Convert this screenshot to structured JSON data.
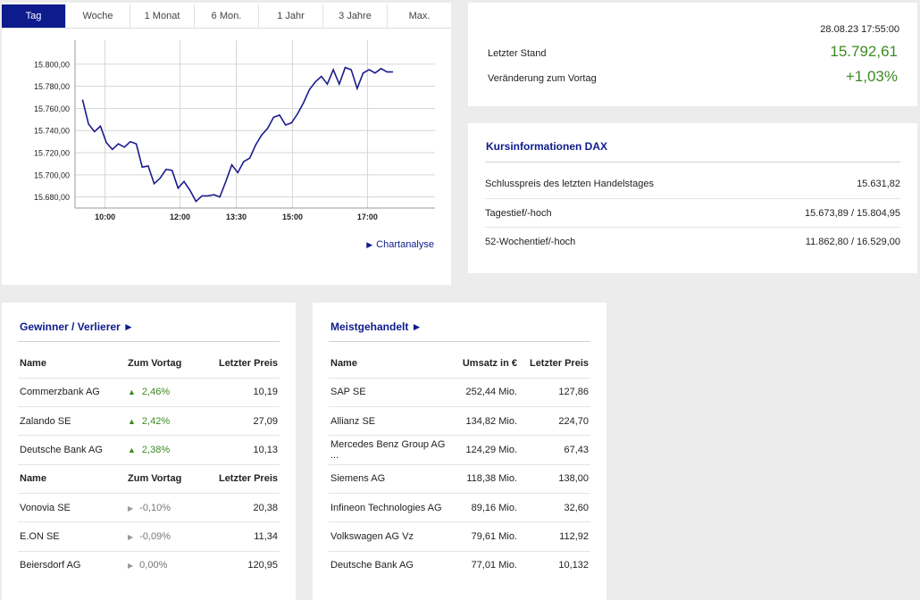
{
  "tabs": [
    "Tag",
    "Woche",
    "1 Monat",
    "6 Mon.",
    "1 Jahr",
    "3 Jahre",
    "Max."
  ],
  "active_tab": 0,
  "chart_link": "Chartanalyse",
  "chart_data": {
    "type": "line",
    "x_ticks": [
      "10:00",
      "12:00",
      "13:30",
      "15:00",
      "17:00"
    ],
    "y_ticks": [
      "15.800,00",
      "15.780,00",
      "15.760,00",
      "15.740,00",
      "15.720,00",
      "15.700,00",
      "15.680,00"
    ],
    "ylim": [
      15670,
      15812
    ],
    "xlim": [
      0,
      48
    ],
    "x_tick_positions": [
      4,
      14,
      21.5,
      29,
      39
    ],
    "y_tick_values": [
      15800,
      15780,
      15760,
      15740,
      15720,
      15700,
      15680
    ],
    "series": [
      {
        "color": "#1a1a8c",
        "values": [
          15768,
          15746,
          15739,
          15744,
          15729,
          15723,
          15728,
          15725,
          15730,
          15728,
          15707,
          15708,
          15692,
          15697,
          15705,
          15704,
          15688,
          15694,
          15686,
          15676,
          15681,
          15681,
          15682,
          15680,
          15694,
          15709,
          15702,
          15712,
          15715,
          15727,
          15736,
          15742,
          15752,
          15754,
          15745,
          15747,
          15755,
          15765,
          15777,
          15784,
          15789,
          15782,
          15795,
          15782,
          15797,
          15795,
          15778,
          15792,
          15795,
          15792,
          15796,
          15793,
          15793
        ]
      }
    ]
  },
  "stand": {
    "datetime": "28.08.23 17:55:00",
    "last_label": "Letzter Stand",
    "last_value": "15.792,61",
    "change_label": "Veränderung zum Vortag",
    "change_value": "+1,03%"
  },
  "kurs": {
    "title": "Kursinformationen DAX",
    "rows": [
      {
        "label": "Schlusspreis des letzten Handelstages",
        "value": "15.631,82"
      },
      {
        "label": "Tagestief/-hoch",
        "value": "15.673,89 / 15.804,95"
      },
      {
        "label": "52-Wochentief/-hoch",
        "value": "11.862,80 / 16.529,00"
      }
    ]
  },
  "gewinner": {
    "title": "Gewinner / Verlierer ►",
    "headers": [
      "Name",
      "Zum Vortag",
      "Letzter Preis"
    ],
    "winners": [
      {
        "name": "Commerzbank AG",
        "change": "2,46%",
        "price": "10,19"
      },
      {
        "name": "Zalando SE",
        "change": "2,42%",
        "price": "27,09"
      },
      {
        "name": "Deutsche Bank AG",
        "change": "2,38%",
        "price": "10,13"
      }
    ],
    "losers": [
      {
        "name": "Vonovia SE",
        "change": "-0,10%",
        "price": "20,38"
      },
      {
        "name": "E.ON SE",
        "change": "-0,09%",
        "price": "11,34"
      },
      {
        "name": "Beiersdorf AG",
        "change": "0,00%",
        "price": "120,95"
      }
    ]
  },
  "meist": {
    "title": "Meistgehandelt ►",
    "headers": [
      "Name",
      "Umsatz in €",
      "Letzter Preis"
    ],
    "rows": [
      {
        "name": "SAP SE",
        "umsatz": "252,44 Mio.",
        "price": "127,86"
      },
      {
        "name": "Allianz SE",
        "umsatz": "134,82 Mio.",
        "price": "224,70"
      },
      {
        "name": "Mercedes Benz Group AG ...",
        "umsatz": "124,29 Mio.",
        "price": "67,43"
      },
      {
        "name": "Siemens AG",
        "umsatz": "118,38 Mio.",
        "price": "138,00"
      },
      {
        "name": "Infineon Technologies AG",
        "umsatz": "89,16 Mio.",
        "price": "32,60"
      },
      {
        "name": "Volkswagen AG Vz",
        "umsatz": "79,61 Mio.",
        "price": "112,92"
      },
      {
        "name": "Deutsche Bank AG",
        "umsatz": "77,01 Mio.",
        "price": "10,132"
      }
    ]
  }
}
